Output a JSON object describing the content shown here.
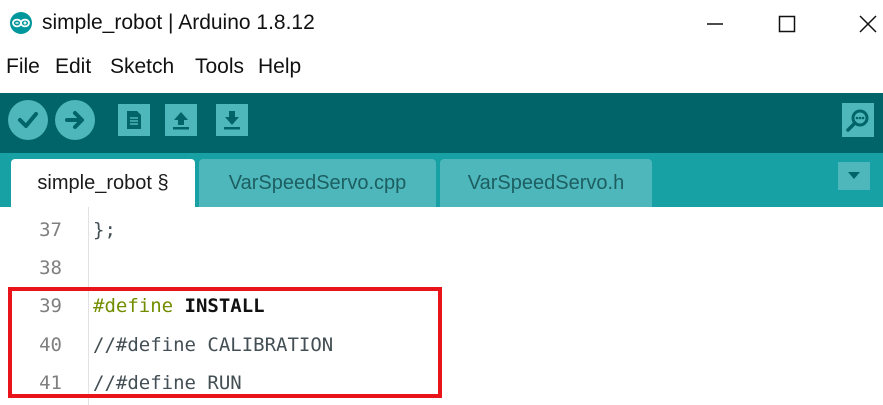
{
  "window": {
    "title": "simple_robot | Arduino 1.8.12",
    "icon": "arduino-logo-icon",
    "controls": [
      "minimize-icon",
      "maximize-icon",
      "close-icon"
    ]
  },
  "menu": {
    "items": [
      "File",
      "Edit",
      "Sketch",
      "Tools",
      "Help"
    ]
  },
  "toolbar": {
    "buttons": [
      "verify-icon",
      "upload-icon",
      "new-icon",
      "open-icon",
      "save-icon"
    ],
    "right_button": "serial-monitor-icon"
  },
  "tabs": [
    {
      "label": "simple_robot §",
      "active": true
    },
    {
      "label": "VarSpeedServo.cpp",
      "active": false
    },
    {
      "label": "VarSpeedServo.h",
      "active": false
    }
  ],
  "editor": {
    "lines": [
      {
        "number": "37",
        "code": "};"
      },
      {
        "number": "38",
        "code": ""
      },
      {
        "number": "39",
        "keyword": "#define",
        "rest": " INSTALL"
      },
      {
        "number": "40",
        "code": "//#define CALIBRATION"
      },
      {
        "number": "41",
        "code": "//#define RUN"
      }
    ]
  },
  "colors": {
    "toolbar": "#006468",
    "tabbar": "#17a1a5",
    "button": "#4db7bb",
    "highlight": "#e8141a",
    "keyword": "#728e00"
  }
}
